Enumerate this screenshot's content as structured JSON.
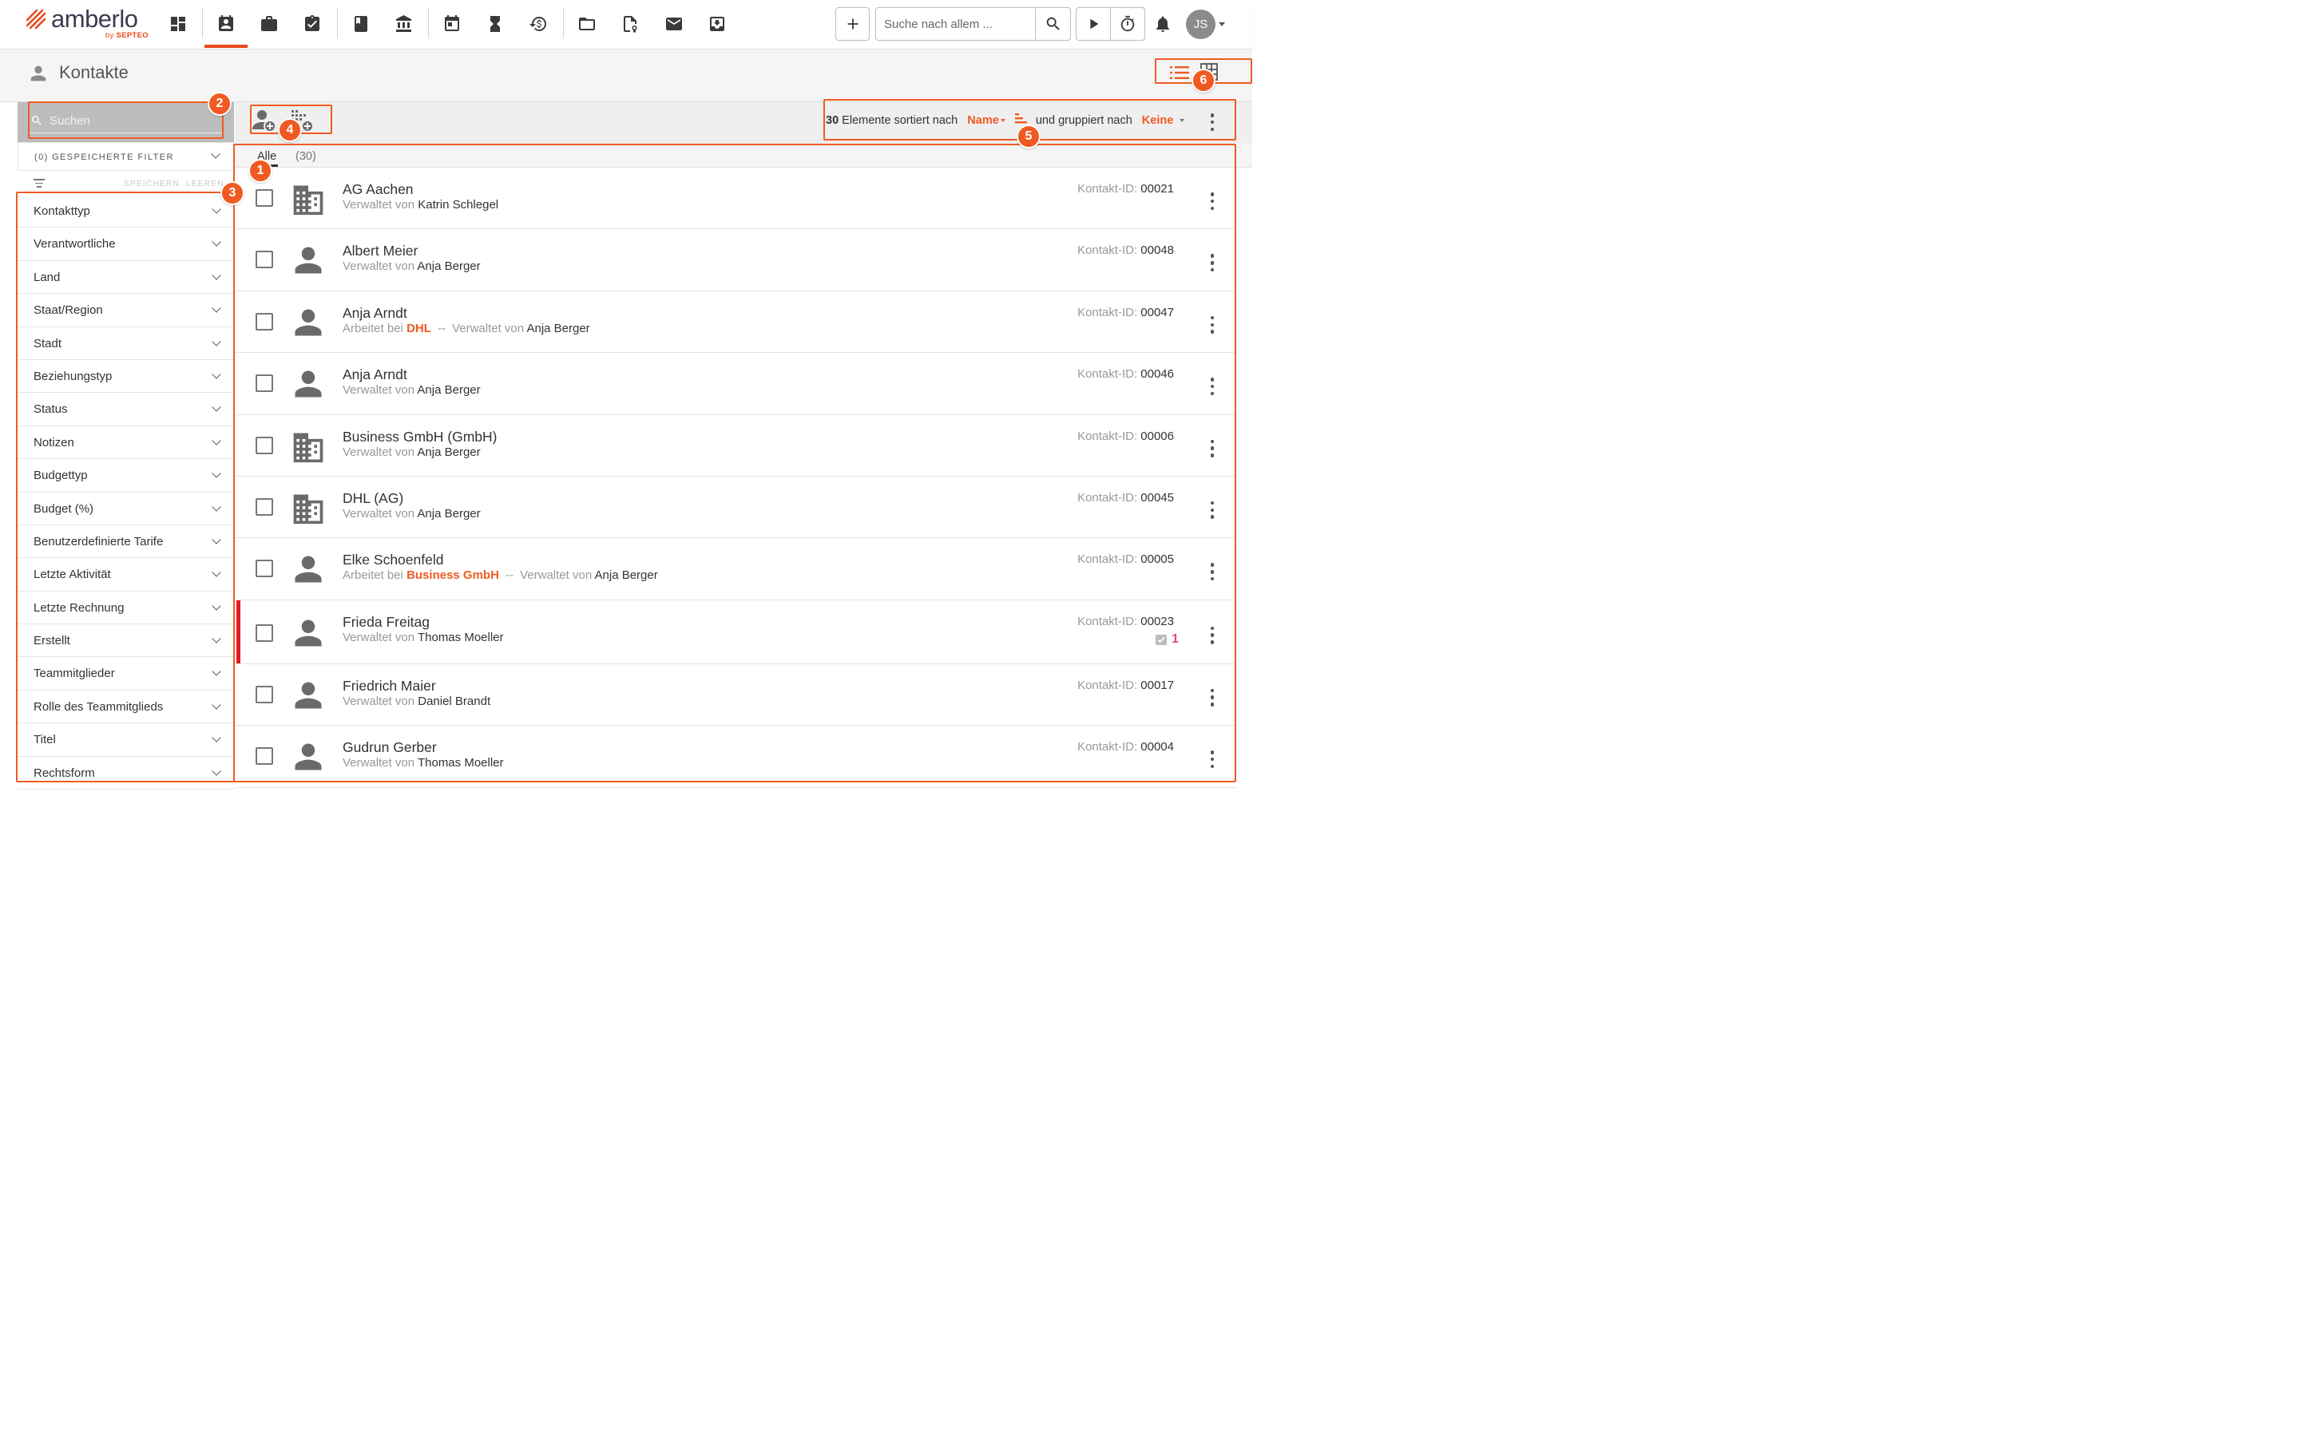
{
  "app": {
    "logo_text": "amberlo",
    "logo_sub_prefix": "by",
    "logo_sub_brand": "SEPTEO"
  },
  "nav": {
    "icons": [
      "dashboard-icon",
      "contacts-icon",
      "briefcase-icon",
      "tasks-icon",
      "book-icon",
      "bank-icon",
      "calendar-icon",
      "hourglass-icon",
      "billing-history-icon",
      "folder-icon",
      "document-certificate-icon",
      "mail-icon",
      "inbox-download-icon"
    ],
    "active": "contacts-icon",
    "search_placeholder": "Suche nach allem ...",
    "user_initials": "JS"
  },
  "page": {
    "title": "Kontakte",
    "view_modes": [
      "list-view-icon",
      "grid-view-icon"
    ],
    "active_view": "list-view-icon"
  },
  "sidebar": {
    "search_placeholder": "Suchen",
    "saved_filters_label": "(0) GESPEICHERTE FILTER",
    "save_label": "SPEICHERN",
    "clear_label": "LEEREN",
    "filters": [
      {
        "label": "Kontakttyp"
      },
      {
        "label": "Verantwortliche"
      },
      {
        "label": "Land"
      },
      {
        "label": "Staat/Region"
      },
      {
        "label": "Stadt"
      },
      {
        "label": "Beziehungstyp"
      },
      {
        "label": "Status"
      },
      {
        "label": "Notizen"
      },
      {
        "label": "Budgettyp"
      },
      {
        "label": "Budget (%)"
      },
      {
        "label": "Benutzerdefinierte Tarife"
      },
      {
        "label": "Letzte Aktivität"
      },
      {
        "label": "Letzte Rechnung"
      },
      {
        "label": "Erstellt"
      },
      {
        "label": "Teammitglieder"
      },
      {
        "label": "Rolle des Teammitglieds"
      },
      {
        "label": "Titel"
      },
      {
        "label": "Rechtsform"
      }
    ]
  },
  "toolbar": {
    "count": "30",
    "sorted_by_text": "Elemente sortiert nach",
    "sort_value": "Name",
    "grouped_by_text": "und gruppiert nach",
    "group_value": "Keine"
  },
  "list": {
    "tab_label": "Alle",
    "tab_count": "(30)",
    "kid_label": "Kontakt-ID:",
    "managed_by": "Verwaltet von",
    "works_at": "Arbeitet bei",
    "separator": "--",
    "rows": [
      {
        "type": "company",
        "name": "AG Aachen",
        "manager": "Katrin Schlegel",
        "id": "00021"
      },
      {
        "type": "person",
        "name": "Albert Meier",
        "manager": "Anja Berger",
        "id": "00048"
      },
      {
        "type": "person",
        "name": "Anja Arndt",
        "employer": "DHL",
        "manager": "Anja Berger",
        "id": "00047"
      },
      {
        "type": "person",
        "name": "Anja Arndt",
        "manager": "Anja Berger",
        "id": "00046"
      },
      {
        "type": "company",
        "name": "Business GmbH (GmbH)",
        "manager": "Anja Berger",
        "id": "00006"
      },
      {
        "type": "company",
        "name": "DHL (AG)",
        "manager": "Anja Berger",
        "id": "00045"
      },
      {
        "type": "person",
        "name": "Elke Schoenfeld",
        "employer": "Business GmbH",
        "manager": "Anja Berger",
        "id": "00005"
      },
      {
        "type": "person",
        "name": "Frieda Freitag",
        "manager": "Thomas Moeller",
        "id": "00023",
        "flagged": true,
        "open_tasks": "1"
      },
      {
        "type": "person",
        "name": "Friedrich Maier",
        "manager": "Daniel Brandt",
        "id": "00017"
      },
      {
        "type": "person",
        "name": "Gudrun Gerber",
        "manager": "Thomas Moeller",
        "id": "00004"
      }
    ]
  },
  "annotations": [
    "1",
    "2",
    "3",
    "4",
    "5",
    "6"
  ],
  "colors": {
    "accent": "#f05a22",
    "flag": "#e31b23",
    "task_count": "#e84a6a"
  }
}
